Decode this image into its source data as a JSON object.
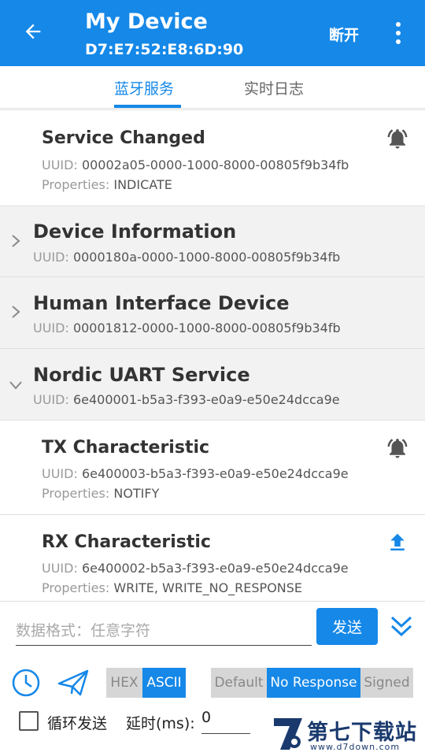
{
  "appbar": {
    "title": "My Device",
    "address": "D7:E7:52:E8:6D:90",
    "disconnect_label": "断开"
  },
  "tabs": [
    {
      "label": "蓝牙服务",
      "active": true
    },
    {
      "label": "实时日志",
      "active": false
    }
  ],
  "labels": {
    "uuid": "UUID: ",
    "properties": "Properties: "
  },
  "items": [
    {
      "kind": "characteristic",
      "name": "Service Changed",
      "uuid": "00002a05-0000-1000-8000-00805f9b34fb",
      "properties": "INDICATE",
      "icon": "bell-icon"
    },
    {
      "kind": "service",
      "name": "Device Information",
      "uuid": "0000180a-0000-1000-8000-00805f9b34fb",
      "expanded": false
    },
    {
      "kind": "service",
      "name": "Human Interface Device",
      "uuid": "00001812-0000-1000-8000-00805f9b34fb",
      "expanded": false
    },
    {
      "kind": "service",
      "name": "Nordic UART Service",
      "uuid": "6e400001-b5a3-f393-e0a9-e50e24dcca9e",
      "expanded": true
    },
    {
      "kind": "characteristic",
      "name": "TX Characteristic",
      "uuid": "6e400003-b5a3-f393-e0a9-e50e24dcca9e",
      "properties": "NOTIFY",
      "icon": "bell-icon"
    },
    {
      "kind": "characteristic",
      "name": "RX Characteristic",
      "uuid": "6e400002-b5a3-f393-e0a9-e50e24dcca9e",
      "properties": "WRITE, WRITE_NO_RESPONSE",
      "icon": "upload-icon"
    }
  ],
  "bottom": {
    "input_placeholder": "数据格式：任意字符",
    "send_label": "发送",
    "format_options": [
      {
        "label": "HEX",
        "selected": false
      },
      {
        "label": "ASCII",
        "selected": true
      }
    ],
    "write_options": [
      {
        "label": "Default",
        "selected": false
      },
      {
        "label": "No Response",
        "selected": true
      },
      {
        "label": "Signed",
        "selected": false
      }
    ],
    "loop_label": "循环发送",
    "loop_checked": false,
    "delay_label": "延时(ms):",
    "delay_value": "0"
  },
  "watermark": {
    "text": "第七下载站",
    "url": "www.d7down.com"
  },
  "colors": {
    "primary": "#1588e8",
    "service_bg": "#f2f2f2"
  }
}
